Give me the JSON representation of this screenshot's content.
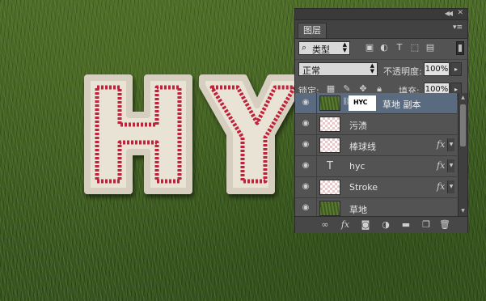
{
  "colors": {
    "panel_bg": "#535353",
    "selected_layer": "#5a6b80",
    "stitch_red": "#c0243a",
    "patch_white": "#e9e3d6",
    "grass": "#3f5f24"
  },
  "panel": {
    "tab_label": "图层",
    "filter": {
      "search_icon": "search-icon",
      "selected": "类型",
      "icons": [
        "image-filter-icon",
        "adjustment-filter-icon",
        "text-filter-icon",
        "shape-filter-icon",
        "smart-object-filter-icon"
      ]
    },
    "blend_mode": "正常",
    "opacity_label": "不透明度:",
    "opacity_value": "100%",
    "lock_label": "锁定:",
    "lock_icons": [
      "lock-transparent-pixels-icon",
      "lock-image-pixels-icon",
      "lock-position-icon",
      "lock-all-icon"
    ],
    "fill_label": "填充:",
    "fill_value": "100%",
    "layers": [
      {
        "name": "草地 副本",
        "thumb": "grass",
        "mask_text": "HYC",
        "selected": true,
        "fx": false
      },
      {
        "name": "污渍",
        "thumb": "transparent",
        "selected": false,
        "fx": false
      },
      {
        "name": "棒球线",
        "thumb": "transparent",
        "selected": false,
        "fx": true
      },
      {
        "name": "hyc",
        "thumb": "type",
        "selected": false,
        "fx": true
      },
      {
        "name": "Stroke",
        "thumb": "transparent",
        "selected": false,
        "fx": true
      },
      {
        "name": "草地",
        "thumb": "grass",
        "selected": false,
        "fx": false
      }
    ],
    "fx_label": "fx",
    "footer_icons": [
      "link-layers-icon",
      "add-layer-style-icon",
      "add-mask-icon",
      "new-adjustment-layer-icon",
      "new-group-icon",
      "new-layer-icon",
      "delete-layer-icon"
    ]
  },
  "canvas": {
    "artwork_text": "HY"
  }
}
